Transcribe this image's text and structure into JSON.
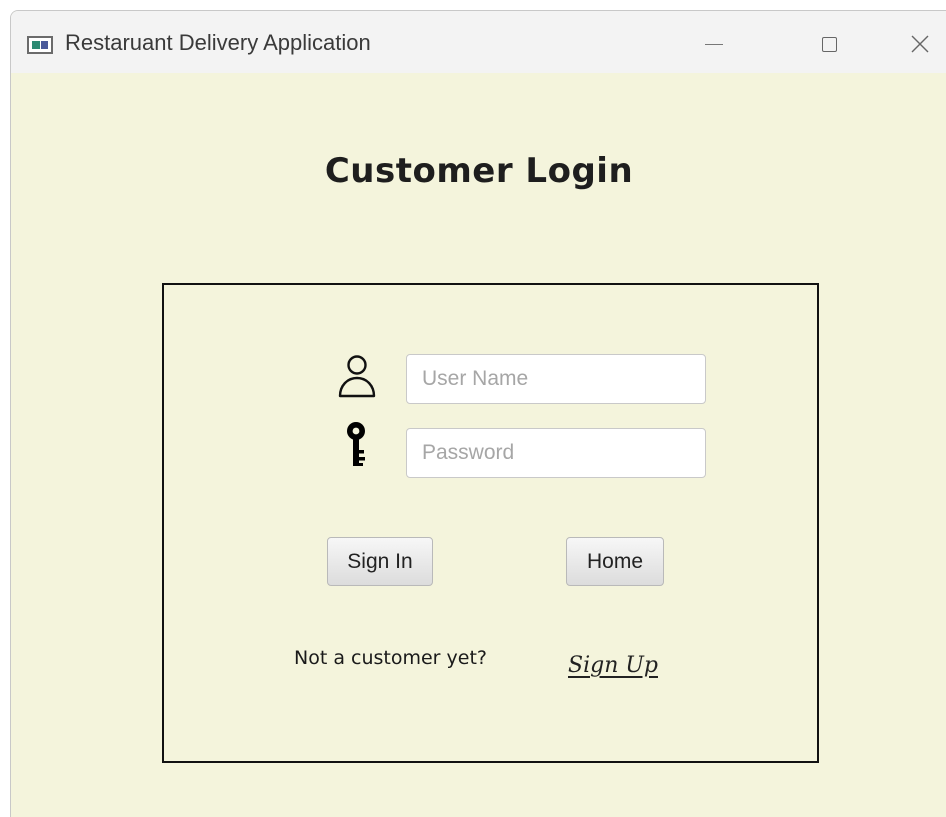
{
  "window": {
    "title": "Restaruant Delivery Application",
    "icons": {
      "app": "app-window-icon",
      "minimize": "minimize-icon",
      "maximize": "maximize-icon",
      "close": "close-icon"
    },
    "close_glyph": "✕"
  },
  "login": {
    "heading": "Customer Login",
    "username_placeholder": "User Name",
    "username_value": "",
    "password_placeholder": "Password",
    "password_value": "",
    "signin_label": "Sign In",
    "home_label": "Home",
    "not_customer_text": "Not a customer yet?",
    "signup_label": "Sign Up",
    "icons": {
      "user": "user-icon",
      "password": "key-icon"
    }
  },
  "colors": {
    "background": "#f4f4dc",
    "titlebar": "#f3f3f3",
    "border": "#111111"
  }
}
